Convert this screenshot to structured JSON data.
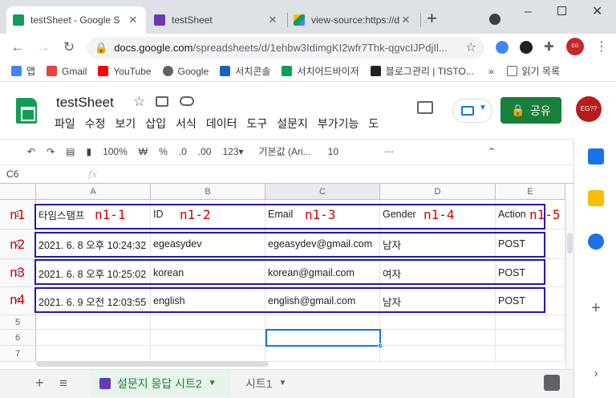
{
  "browser": {
    "tabs": [
      {
        "title": "testSheet - Google S",
        "color": "#0f9d58"
      },
      {
        "title": "testSheet",
        "color": "#673ab7"
      },
      {
        "title": "view-source:https://d",
        "color": "#fbbc04"
      }
    ],
    "new_tab": "+",
    "url_domain": "docs.google.com",
    "url_path": "/spreadsheets/d/1ehbw3IdimgKI2wfr7Thk-qgvcIJPdjIl...",
    "bookmarks": [
      "앱",
      "Gmail",
      "YouTube",
      "Google",
      "서치콘솔",
      "서치어드바이저",
      "블로그관리 | TISTO..."
    ],
    "bookmark_colors": [
      "#4285f4",
      "#ea4335",
      "#ff0000",
      "#5f6368",
      "#1565c0",
      "#0f9d58",
      "#202124"
    ],
    "reading_list": "읽기 목록",
    "more": "»"
  },
  "sheets": {
    "title": "testSheet",
    "menus": [
      "파일",
      "수정",
      "보기",
      "삽입",
      "서식",
      "데이터",
      "도구",
      "설문지",
      "부가기능",
      "도"
    ],
    "share_label": "공유",
    "avatar_text": "EG??",
    "toolbar": {
      "zoom": "100%",
      "currency": "₩",
      "percent": "%",
      "dec_less": ".0",
      "dec_more": ".00",
      "num_format": "123▾",
      "font": "기본값 (Ari...",
      "font_size": "10",
      "more": "⋯"
    },
    "name_box": "C6",
    "fx": "fx"
  },
  "grid": {
    "columns": [
      "A",
      "B",
      "C",
      "D",
      "E"
    ],
    "rows": [
      {
        "num": "1",
        "cells": [
          "타임스탬프",
          "ID",
          "Email",
          "Gender",
          "Action"
        ]
      },
      {
        "num": "2",
        "cells": [
          "2021. 6. 8 오후 10:24:32",
          "egeasydev",
          "egeasydev@gmail.com",
          "남자",
          "POST"
        ]
      },
      {
        "num": "3",
        "cells": [
          "2021. 6. 8 오후 10:25:02",
          "korean",
          "korean@gmail.com",
          "여자",
          "POST"
        ]
      },
      {
        "num": "4",
        "cells": [
          "2021. 6. 9 오전 12:03:55",
          "english",
          "english@gmail.com",
          "남자",
          "POST"
        ]
      },
      {
        "num": "5",
        "cells": [
          "",
          "",
          "",
          "",
          ""
        ]
      },
      {
        "num": "6",
        "cells": [
          "",
          "",
          "",
          "",
          ""
        ]
      },
      {
        "num": "7",
        "cells": [
          "",
          "",
          "",
          "",
          ""
        ]
      }
    ]
  },
  "annotations": {
    "row_labels": [
      "n1",
      "n2",
      "n3",
      "n4"
    ],
    "col_labels": [
      "n1-1",
      "n1-2",
      "n1-3",
      "n1-4",
      "n1-5"
    ]
  },
  "sheet_tabs": {
    "add": "+",
    "list": "≡",
    "active": "설문지 응답 시트2",
    "other": "시트1"
  }
}
